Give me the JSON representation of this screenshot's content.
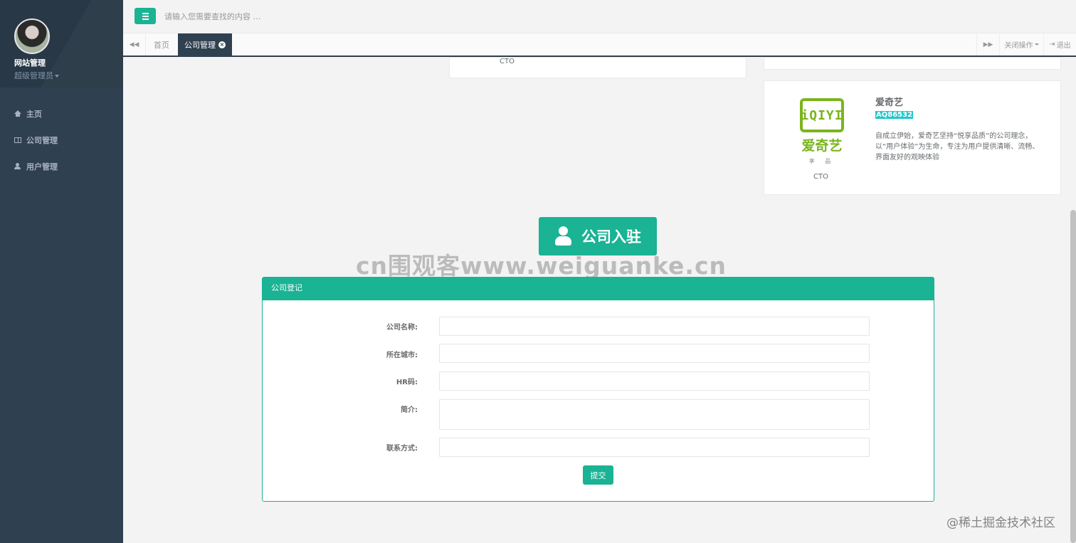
{
  "sidebar": {
    "site_name": "网站管理",
    "role": "超级管理员",
    "items": [
      {
        "label": "主页",
        "icon": "home-icon"
      },
      {
        "label": "公司管理",
        "icon": "columns-icon"
      },
      {
        "label": "用户管理",
        "icon": "user-icon"
      }
    ]
  },
  "topbar": {
    "search_placeholder": "请输入您需要查找的内容 …"
  },
  "tabs": {
    "prev_icon": "backward-icon",
    "home_label": "首页",
    "active_label": "公司管理",
    "next_icon": "forward-icon",
    "ops_label": "关闭操作",
    "exit_label": "退出"
  },
  "cards": {
    "partial_left_role": "CTO",
    "iqiyi": {
      "logo_text": "iQIYI",
      "logo_cn": "爱奇艺",
      "logo_sub": "享 品",
      "role": "CTO",
      "name": "爱奇艺",
      "code": "AQ86532",
      "desc": "自成立伊始，爱奇艺坚持“悦享品质”的公司理念，以“用户体验”为生命，专注为用户提供清晰、流畅、界面友好的观映体验"
    }
  },
  "join_button": {
    "label": "公司入驻",
    "icon": "user-icon"
  },
  "watermark": "cn围观客www.weiguanke.cn",
  "form": {
    "title": "公司登记",
    "fields": [
      {
        "label": "公司名称:",
        "value": ""
      },
      {
        "label": "所在城市:",
        "value": ""
      },
      {
        "label": "HR码:",
        "value": ""
      },
      {
        "label": "简介:",
        "value": ""
      },
      {
        "label": "联系方式:",
        "value": ""
      }
    ],
    "submit_label": "提交"
  },
  "footer_watermark": "@稀土掘金技术社区",
  "colors": {
    "accent": "#1ab394",
    "sidebar": "#2f4050",
    "badge": "#23c6c8"
  }
}
